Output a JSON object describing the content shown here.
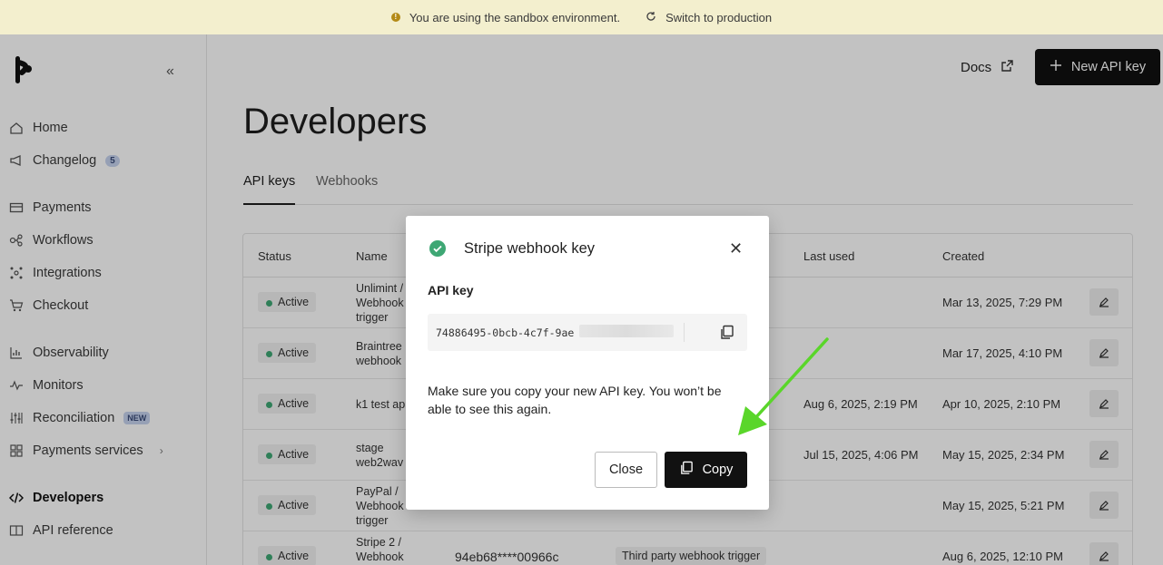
{
  "banner": {
    "message": "You are using the sandbox environment.",
    "switch_label": "Switch to production"
  },
  "sidebar": {
    "collapse_glyph": "«",
    "items": [
      {
        "label": "Home",
        "icon": "home-icon"
      },
      {
        "label": "Changelog",
        "icon": "megaphone-icon",
        "badge": "5"
      },
      {
        "label": "Payments",
        "icon": "card-icon"
      },
      {
        "label": "Workflows",
        "icon": "workflow-icon"
      },
      {
        "label": "Integrations",
        "icon": "integrations-icon"
      },
      {
        "label": "Checkout",
        "icon": "cart-icon"
      },
      {
        "label": "Observability",
        "icon": "chart-icon"
      },
      {
        "label": "Monitors",
        "icon": "pulse-icon"
      },
      {
        "label": "Reconciliation",
        "icon": "sliders-icon",
        "badge": "NEW"
      },
      {
        "label": "Payments services",
        "icon": "grid-icon"
      },
      {
        "label": "Developers",
        "icon": "code-icon"
      },
      {
        "label": "API reference",
        "icon": "book-icon"
      }
    ]
  },
  "header": {
    "docs_label": "Docs",
    "new_key_label": "New API key"
  },
  "page": {
    "title": "Developers"
  },
  "tabs": [
    {
      "label": "API keys"
    },
    {
      "label": "Webhooks"
    }
  ],
  "table": {
    "headers": {
      "status": "Status",
      "name": "Name",
      "last_used": "Last used",
      "created": "Created"
    },
    "rows": [
      {
        "status": "Active",
        "name": "Unlimint / Webhook trigger",
        "key": "",
        "type": "",
        "last_used": "",
        "created": "Mar 13, 2025, 7:29 PM"
      },
      {
        "status": "Active",
        "name": "Braintree webhook",
        "key": "",
        "type": "",
        "last_used": "",
        "created": "Mar 17, 2025, 4:10 PM"
      },
      {
        "status": "Active",
        "name": "k1 test ap",
        "key": "",
        "type": "",
        "last_used": "Aug 6, 2025, 2:19 PM",
        "created": "Apr 10, 2025, 2:10 PM"
      },
      {
        "status": "Active",
        "name": "stage web2wav",
        "key": "",
        "type": "",
        "last_used": "Jul 15, 2025, 4:06 PM",
        "created": "May 15, 2025, 2:34 PM"
      },
      {
        "status": "Active",
        "name": "PayPal / Webhook trigger",
        "key": "",
        "type": "",
        "last_used": "",
        "created": "May 15, 2025, 5:21 PM"
      },
      {
        "status": "Active",
        "name": "Stripe 2 / Webhook",
        "key": "94eb68****00966c",
        "type": "Third party webhook trigger",
        "last_used": "",
        "created": "Aug 6, 2025, 12:10 PM"
      }
    ]
  },
  "modal": {
    "title": "Stripe webhook key",
    "key_label": "API key",
    "key_value": "74886495-0bcb-4c7f-9ae",
    "note": "Make sure you copy your new API key. You won’t be able to see this again.",
    "close_label": "Close",
    "copy_label": "Copy",
    "close_glyph": "✕"
  },
  "colors": {
    "accent": "#111111",
    "success": "#3ea774",
    "banner_bg": "#f3efce",
    "arrow": "#5ad62a"
  }
}
